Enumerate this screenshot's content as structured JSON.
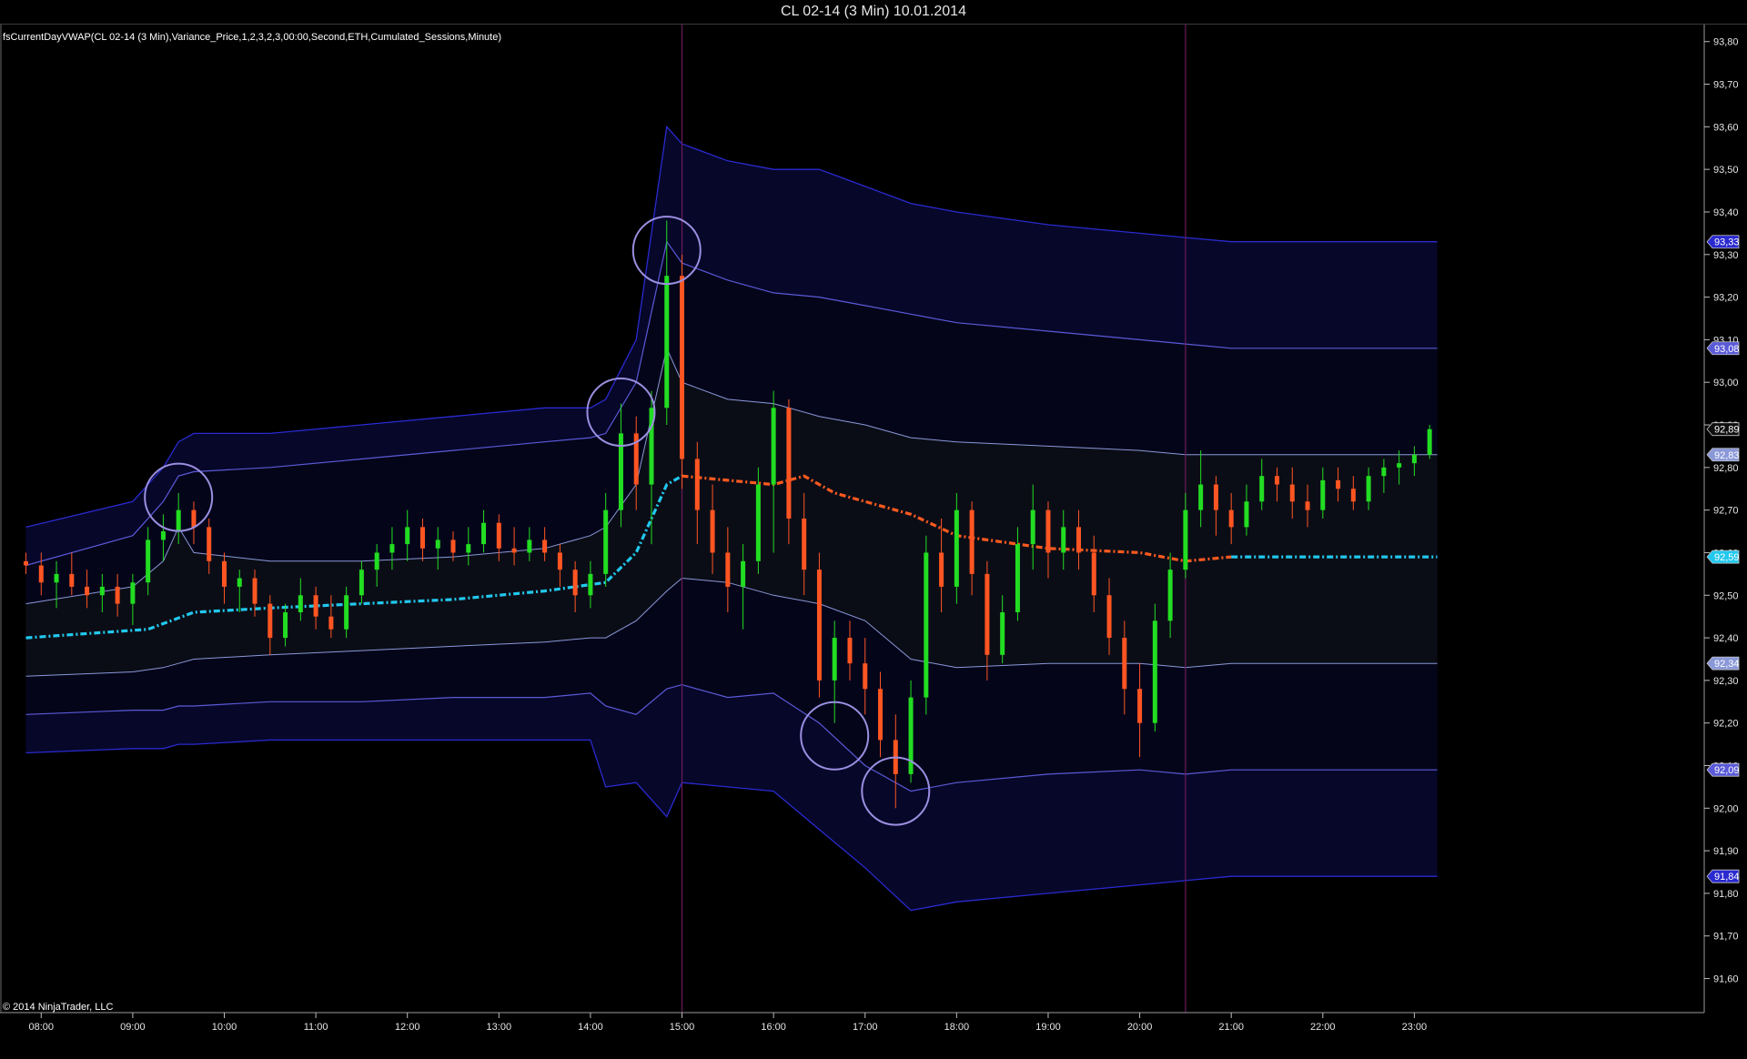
{
  "window": {
    "title": "CL 02-14 (3 Min)  10.01.2014"
  },
  "indicator_label": "fsCurrentDayVWAP(CL 02-14 (3 Min),Variance_Price,1,2,3,2,3,00:00,Second,ETH,Cumulated_Sessions,Minute)",
  "copyright": "© 2014 NinjaTrader, LLC",
  "colors": {
    "background": "#000000",
    "up_candle": "#22dd22",
    "down_candle": "#ff5522",
    "vwap_pre": "#22c8ee",
    "vwap_mid": "#ff5a1f",
    "band_inner": "#8a98d8",
    "band_mid": "#5a5ad8",
    "band_outer": "#2a2ad0",
    "session_line": "#6a1a5a",
    "circle": "#9b8fe0"
  },
  "chart_data": {
    "type": "candlestick",
    "symbol": "CL 02-14",
    "timeframe": "3 Min",
    "date": "10.01.2014",
    "x_ticks": [
      "08:00",
      "09:00",
      "10:00",
      "11:00",
      "12:00",
      "13:00",
      "14:00",
      "15:00",
      "16:00",
      "17:00",
      "18:00",
      "19:00",
      "20:00",
      "21:00",
      "22:00",
      "23:00"
    ],
    "y_ticks": [
      "93,80",
      "93,70",
      "93,60",
      "93,50",
      "93,40",
      "93,30",
      "93,20",
      "93,10",
      "93,00",
      "92,90",
      "92,80",
      "92,70",
      "92,60",
      "92,50",
      "92,40",
      "92,30",
      "92,20",
      "92,10",
      "92,00",
      "91,90",
      "91,80",
      "91,70",
      "91,60"
    ],
    "ylim": [
      91.52,
      93.84
    ],
    "session_breaks": [
      "15:00",
      "20:30"
    ],
    "price_tags": [
      {
        "label": "93,33",
        "value": 93.33,
        "color": "#2a2ad0"
      },
      {
        "label": "93,08",
        "value": 93.08,
        "color": "#5a5ad8"
      },
      {
        "label": "92,89",
        "value": 92.89,
        "color": "#101010"
      },
      {
        "label": "92,83",
        "value": 92.83,
        "color": "#8a98d8"
      },
      {
        "label": "92,59",
        "value": 92.59,
        "color": "#22c8ee"
      },
      {
        "label": "92,34",
        "value": 92.34,
        "color": "#8a98d8"
      },
      {
        "label": "92,09",
        "value": 92.09,
        "color": "#5a5ad8"
      },
      {
        "label": "91,84",
        "value": 91.84,
        "color": "#2a2ad0"
      }
    ],
    "series": [
      {
        "time": "07:50",
        "open": 92.58,
        "high": 92.6,
        "low": 92.55,
        "close": 92.57
      },
      {
        "time": "08:00",
        "open": 92.57,
        "high": 92.6,
        "low": 92.5,
        "close": 92.53
      },
      {
        "time": "08:10",
        "open": 92.53,
        "high": 92.58,
        "low": 92.47,
        "close": 92.55
      },
      {
        "time": "08:20",
        "open": 92.55,
        "high": 92.6,
        "low": 92.5,
        "close": 92.52
      },
      {
        "time": "08:30",
        "open": 92.52,
        "high": 92.56,
        "low": 92.47,
        "close": 92.5
      },
      {
        "time": "08:40",
        "open": 92.5,
        "high": 92.55,
        "low": 92.46,
        "close": 92.52
      },
      {
        "time": "08:50",
        "open": 92.52,
        "high": 92.55,
        "low": 92.45,
        "close": 92.48
      },
      {
        "time": "09:00",
        "open": 92.48,
        "high": 92.55,
        "low": 92.43,
        "close": 92.53
      },
      {
        "time": "09:10",
        "open": 92.53,
        "high": 92.66,
        "low": 92.5,
        "close": 92.63
      },
      {
        "time": "09:20",
        "open": 92.63,
        "high": 92.69,
        "low": 92.58,
        "close": 92.65
      },
      {
        "time": "09:30",
        "open": 92.65,
        "high": 92.74,
        "low": 92.62,
        "close": 92.7
      },
      {
        "time": "09:40",
        "open": 92.7,
        "high": 92.72,
        "low": 92.62,
        "close": 92.66
      },
      {
        "time": "09:50",
        "open": 92.66,
        "high": 92.68,
        "low": 92.55,
        "close": 92.58
      },
      {
        "time": "10:00",
        "open": 92.58,
        "high": 92.6,
        "low": 92.48,
        "close": 92.52
      },
      {
        "time": "10:10",
        "open": 92.52,
        "high": 92.56,
        "low": 92.46,
        "close": 92.54
      },
      {
        "time": "10:20",
        "open": 92.54,
        "high": 92.56,
        "low": 92.45,
        "close": 92.48
      },
      {
        "time": "10:30",
        "open": 92.48,
        "high": 92.5,
        "low": 92.36,
        "close": 92.4
      },
      {
        "time": "10:40",
        "open": 92.4,
        "high": 92.48,
        "low": 92.38,
        "close": 92.46
      },
      {
        "time": "10:50",
        "open": 92.46,
        "high": 92.54,
        "low": 92.44,
        "close": 92.5
      },
      {
        "time": "11:00",
        "open": 92.5,
        "high": 92.52,
        "low": 92.42,
        "close": 92.45
      },
      {
        "time": "11:10",
        "open": 92.45,
        "high": 92.5,
        "low": 92.4,
        "close": 92.42
      },
      {
        "time": "11:20",
        "open": 92.42,
        "high": 92.52,
        "low": 92.4,
        "close": 92.5
      },
      {
        "time": "11:30",
        "open": 92.5,
        "high": 92.58,
        "low": 92.48,
        "close": 92.56
      },
      {
        "time": "11:40",
        "open": 92.56,
        "high": 92.62,
        "low": 92.52,
        "close": 92.6
      },
      {
        "time": "11:50",
        "open": 92.6,
        "high": 92.66,
        "low": 92.56,
        "close": 92.62
      },
      {
        "time": "12:00",
        "open": 92.62,
        "high": 92.7,
        "low": 92.58,
        "close": 92.66
      },
      {
        "time": "12:10",
        "open": 92.66,
        "high": 92.68,
        "low": 92.58,
        "close": 92.61
      },
      {
        "time": "12:20",
        "open": 92.61,
        "high": 92.66,
        "low": 92.56,
        "close": 92.63
      },
      {
        "time": "12:30",
        "open": 92.63,
        "high": 92.65,
        "low": 92.58,
        "close": 92.6
      },
      {
        "time": "12:40",
        "open": 92.6,
        "high": 92.66,
        "low": 92.57,
        "close": 92.62
      },
      {
        "time": "12:50",
        "open": 92.62,
        "high": 92.7,
        "low": 92.6,
        "close": 92.67
      },
      {
        "time": "13:00",
        "open": 92.67,
        "high": 92.69,
        "low": 92.58,
        "close": 92.61
      },
      {
        "time": "13:10",
        "open": 92.61,
        "high": 92.66,
        "low": 92.57,
        "close": 92.6
      },
      {
        "time": "13:20",
        "open": 92.6,
        "high": 92.66,
        "low": 92.58,
        "close": 92.63
      },
      {
        "time": "13:30",
        "open": 92.63,
        "high": 92.66,
        "low": 92.58,
        "close": 92.6
      },
      {
        "time": "13:40",
        "open": 92.6,
        "high": 92.62,
        "low": 92.52,
        "close": 92.56
      },
      {
        "time": "13:50",
        "open": 92.56,
        "high": 92.58,
        "low": 92.46,
        "close": 92.5
      },
      {
        "time": "14:00",
        "open": 92.5,
        "high": 92.58,
        "low": 92.47,
        "close": 92.55
      },
      {
        "time": "14:10",
        "open": 92.55,
        "high": 92.74,
        "low": 92.52,
        "close": 92.7
      },
      {
        "time": "14:20",
        "open": 92.7,
        "high": 92.95,
        "low": 92.66,
        "close": 92.88
      },
      {
        "time": "14:30",
        "open": 92.88,
        "high": 92.92,
        "low": 92.7,
        "close": 92.76
      },
      {
        "time": "14:40",
        "open": 92.76,
        "high": 92.98,
        "low": 92.62,
        "close": 92.94
      },
      {
        "time": "14:50",
        "open": 92.94,
        "high": 93.38,
        "low": 92.9,
        "close": 93.25
      },
      {
        "time": "15:00",
        "open": 93.25,
        "high": 93.3,
        "low": 92.75,
        "close": 92.82
      },
      {
        "time": "15:10",
        "open": 92.82,
        "high": 92.86,
        "low": 92.62,
        "close": 92.7
      },
      {
        "time": "15:20",
        "open": 92.7,
        "high": 92.76,
        "low": 92.55,
        "close": 92.6
      },
      {
        "time": "15:30",
        "open": 92.6,
        "high": 92.66,
        "low": 92.46,
        "close": 92.52
      },
      {
        "time": "15:40",
        "open": 92.52,
        "high": 92.62,
        "low": 92.42,
        "close": 92.58
      },
      {
        "time": "15:50",
        "open": 92.58,
        "high": 92.8,
        "low": 92.55,
        "close": 92.76
      },
      {
        "time": "16:00",
        "open": 92.76,
        "high": 92.98,
        "low": 92.6,
        "close": 92.94
      },
      {
        "time": "16:10",
        "open": 92.94,
        "high": 92.96,
        "low": 92.62,
        "close": 92.68
      },
      {
        "time": "16:20",
        "open": 92.68,
        "high": 92.74,
        "low": 92.5,
        "close": 92.56
      },
      {
        "time": "16:30",
        "open": 92.56,
        "high": 92.6,
        "low": 92.26,
        "close": 92.3
      },
      {
        "time": "16:40",
        "open": 92.3,
        "high": 92.44,
        "low": 92.2,
        "close": 92.4
      },
      {
        "time": "16:50",
        "open": 92.4,
        "high": 92.44,
        "low": 92.3,
        "close": 92.34
      },
      {
        "time": "17:00",
        "open": 92.34,
        "high": 92.4,
        "low": 92.22,
        "close": 92.28
      },
      {
        "time": "17:10",
        "open": 92.28,
        "high": 92.32,
        "low": 92.12,
        "close": 92.16
      },
      {
        "time": "17:20",
        "open": 92.16,
        "high": 92.22,
        "low": 92.0,
        "close": 92.08
      },
      {
        "time": "17:30",
        "open": 92.08,
        "high": 92.3,
        "low": 92.06,
        "close": 92.26
      },
      {
        "time": "17:40",
        "open": 92.26,
        "high": 92.64,
        "low": 92.22,
        "close": 92.6
      },
      {
        "time": "17:50",
        "open": 92.6,
        "high": 92.68,
        "low": 92.46,
        "close": 92.52
      },
      {
        "time": "18:00",
        "open": 92.52,
        "high": 92.74,
        "low": 92.48,
        "close": 92.7
      },
      {
        "time": "18:10",
        "open": 92.7,
        "high": 92.72,
        "low": 92.5,
        "close": 92.55
      },
      {
        "time": "18:20",
        "open": 92.55,
        "high": 92.58,
        "low": 92.3,
        "close": 92.36
      },
      {
        "time": "18:30",
        "open": 92.36,
        "high": 92.5,
        "low": 92.34,
        "close": 92.46
      },
      {
        "time": "18:40",
        "open": 92.46,
        "high": 92.66,
        "low": 92.44,
        "close": 92.62
      },
      {
        "time": "18:50",
        "open": 92.62,
        "high": 92.76,
        "low": 92.56,
        "close": 92.7
      },
      {
        "time": "19:00",
        "open": 92.7,
        "high": 92.72,
        "low": 92.54,
        "close": 92.6
      },
      {
        "time": "19:10",
        "open": 92.6,
        "high": 92.7,
        "low": 92.56,
        "close": 92.66
      },
      {
        "time": "19:20",
        "open": 92.66,
        "high": 92.7,
        "low": 92.56,
        "close": 92.6
      },
      {
        "time": "19:30",
        "open": 92.6,
        "high": 92.64,
        "low": 92.46,
        "close": 92.5
      },
      {
        "time": "19:40",
        "open": 92.5,
        "high": 92.54,
        "low": 92.36,
        "close": 92.4
      },
      {
        "time": "19:50",
        "open": 92.4,
        "high": 92.44,
        "low": 92.22,
        "close": 92.28
      },
      {
        "time": "20:00",
        "open": 92.28,
        "high": 92.34,
        "low": 92.12,
        "close": 92.2
      },
      {
        "time": "20:10",
        "open": 92.2,
        "high": 92.48,
        "low": 92.18,
        "close": 92.44
      },
      {
        "time": "20:20",
        "open": 92.44,
        "high": 92.6,
        "low": 92.4,
        "close": 92.56
      },
      {
        "time": "20:30",
        "open": 92.56,
        "high": 92.74,
        "low": 92.54,
        "close": 92.7
      },
      {
        "time": "20:40",
        "open": 92.7,
        "high": 92.84,
        "low": 92.66,
        "close": 92.76
      },
      {
        "time": "20:50",
        "open": 92.76,
        "high": 92.78,
        "low": 92.64,
        "close": 92.7
      },
      {
        "time": "21:00",
        "open": 92.7,
        "high": 92.74,
        "low": 92.62,
        "close": 92.66
      },
      {
        "time": "21:10",
        "open": 92.66,
        "high": 92.76,
        "low": 92.64,
        "close": 92.72
      },
      {
        "time": "21:20",
        "open": 92.72,
        "high": 92.82,
        "low": 92.7,
        "close": 92.78
      },
      {
        "time": "21:30",
        "open": 92.78,
        "high": 92.8,
        "low": 92.72,
        "close": 92.76
      },
      {
        "time": "21:40",
        "open": 92.76,
        "high": 92.8,
        "low": 92.68,
        "close": 92.72
      },
      {
        "time": "21:50",
        "open": 92.72,
        "high": 92.76,
        "low": 92.66,
        "close": 92.7
      },
      {
        "time": "22:00",
        "open": 92.7,
        "high": 92.8,
        "low": 92.68,
        "close": 92.77
      },
      {
        "time": "22:10",
        "open": 92.77,
        "high": 92.8,
        "low": 92.72,
        "close": 92.75
      },
      {
        "time": "22:20",
        "open": 92.75,
        "high": 92.78,
        "low": 92.7,
        "close": 92.72
      },
      {
        "time": "22:30",
        "open": 92.72,
        "high": 92.8,
        "low": 92.7,
        "close": 92.78
      },
      {
        "time": "22:40",
        "open": 92.78,
        "high": 92.82,
        "low": 92.74,
        "close": 92.8
      },
      {
        "time": "22:50",
        "open": 92.8,
        "high": 92.84,
        "low": 92.76,
        "close": 92.81
      },
      {
        "time": "23:00",
        "open": 92.81,
        "high": 92.85,
        "low": 92.78,
        "close": 92.83
      },
      {
        "time": "23:10",
        "open": 92.83,
        "high": 92.9,
        "low": 92.82,
        "close": 92.89
      }
    ],
    "vwap": {
      "x": [
        "07:50",
        "08:30",
        "09:10",
        "09:40",
        "10:30",
        "11:30",
        "12:30",
        "13:30",
        "14:10",
        "14:30",
        "14:50",
        "15:00",
        "15:30",
        "16:00",
        "16:20",
        "16:40",
        "17:00",
        "17:30",
        "18:00",
        "19:00",
        "20:00",
        "20:30",
        "21:00",
        "22:00",
        "23:00",
        "23:15"
      ],
      "values": [
        92.4,
        92.41,
        92.42,
        92.46,
        92.47,
        92.48,
        92.49,
        92.51,
        92.53,
        92.6,
        92.76,
        92.78,
        92.77,
        92.76,
        92.78,
        92.74,
        92.72,
        92.69,
        92.64,
        92.61,
        92.6,
        92.58,
        92.59,
        92.59,
        92.59,
        92.59
      ]
    },
    "bands": {
      "x": [
        "07:50",
        "09:00",
        "09:20",
        "09:30",
        "09:40",
        "10:30",
        "11:30",
        "12:30",
        "13:30",
        "14:00",
        "14:10",
        "14:30",
        "14:50",
        "15:00",
        "15:30",
        "16:00",
        "16:30",
        "17:00",
        "17:30",
        "18:00",
        "19:00",
        "20:00",
        "20:30",
        "21:00",
        "22:00",
        "23:15"
      ],
      "upper1": [
        92.48,
        92.52,
        92.58,
        92.66,
        92.6,
        92.58,
        92.58,
        92.59,
        92.61,
        92.64,
        92.66,
        92.76,
        93.08,
        93.0,
        92.96,
        92.95,
        92.92,
        92.9,
        92.87,
        92.86,
        92.85,
        92.84,
        92.83,
        92.83,
        92.83,
        92.83
      ],
      "lower1": [
        92.31,
        92.32,
        92.33,
        92.34,
        92.35,
        92.36,
        92.37,
        92.38,
        92.39,
        92.4,
        92.4,
        92.44,
        92.51,
        92.54,
        92.53,
        92.5,
        92.48,
        92.44,
        92.35,
        92.33,
        92.34,
        92.34,
        92.33,
        92.34,
        92.34,
        92.34
      ],
      "upper2": [
        92.57,
        92.64,
        92.72,
        92.78,
        92.79,
        92.8,
        92.82,
        92.84,
        92.86,
        92.87,
        92.88,
        93.0,
        93.33,
        93.28,
        93.24,
        93.21,
        93.2,
        93.18,
        93.16,
        93.14,
        93.12,
        93.1,
        93.09,
        93.08,
        93.08,
        93.08
      ],
      "lower2": [
        92.22,
        92.23,
        92.23,
        92.24,
        92.24,
        92.25,
        92.25,
        92.26,
        92.26,
        92.27,
        92.24,
        92.22,
        92.28,
        92.29,
        92.26,
        92.27,
        92.2,
        92.1,
        92.04,
        92.06,
        92.08,
        92.09,
        92.08,
        92.09,
        92.09,
        92.09
      ],
      "upper3": [
        92.66,
        92.72,
        92.8,
        92.86,
        92.88,
        92.88,
        92.9,
        92.92,
        92.94,
        92.94,
        92.96,
        93.1,
        93.6,
        93.56,
        93.52,
        93.5,
        93.5,
        93.46,
        93.42,
        93.4,
        93.37,
        93.35,
        93.34,
        93.33,
        93.33,
        93.33
      ],
      "lower3": [
        92.13,
        92.14,
        92.14,
        92.15,
        92.15,
        92.16,
        92.16,
        92.16,
        92.16,
        92.16,
        92.05,
        92.06,
        91.98,
        92.06,
        92.05,
        92.04,
        91.95,
        91.86,
        91.76,
        91.78,
        91.8,
        91.82,
        91.83,
        91.84,
        91.84,
        91.84
      ]
    },
    "highlight_circles": [
      {
        "time": "09:30",
        "value": 92.73
      },
      {
        "time": "14:50",
        "value": 93.31
      },
      {
        "time": "14:20",
        "value": 92.93
      },
      {
        "time": "16:40",
        "value": 92.17
      },
      {
        "time": "17:20",
        "value": 92.04
      }
    ]
  }
}
